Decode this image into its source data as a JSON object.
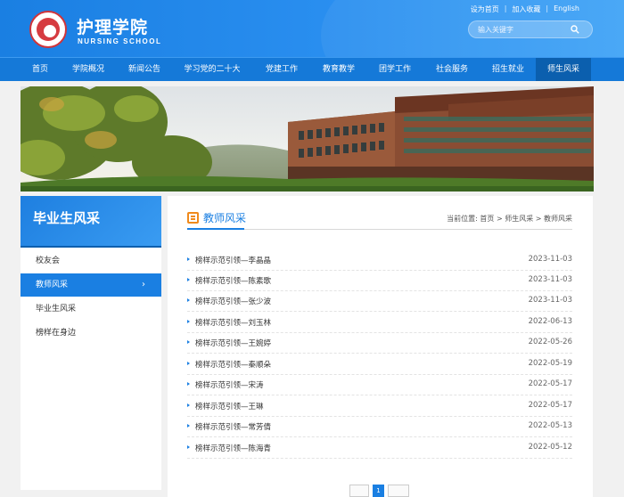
{
  "header": {
    "title": "护理学院",
    "subtitle": "NURSING SCHOOL",
    "logo_icon": "college-seal-logo",
    "top_links": [
      "设为首页",
      "加入收藏",
      "English"
    ],
    "search_placeholder": "输入关键字"
  },
  "nav": {
    "items": [
      "首页",
      "学院概况",
      "新闻公告",
      "学习党的二十大",
      "党建工作",
      "教育教学",
      "团学工作",
      "社会服务",
      "招生就业",
      "师生风采"
    ],
    "active": "师生风采"
  },
  "sidebar": {
    "heading": "毕业生风采",
    "items": [
      {
        "label": "校友会"
      },
      {
        "label": "教师风采"
      },
      {
        "label": "毕业生风采"
      },
      {
        "label": "榜样在身边"
      }
    ],
    "active_index": 1
  },
  "main": {
    "section_title": "教师风采",
    "breadcrumb": {
      "prefix": "当前位置:",
      "home": "首页",
      "level1": "师生风采",
      "level2": "教师风采",
      "sep": ">"
    },
    "articles": [
      {
        "title": "榜样示范引领—李晶晶",
        "date": "2023-11-03"
      },
      {
        "title": "榜样示范引领—陈素歌",
        "date": "2023-11-03"
      },
      {
        "title": "榜样示范引领—张少波",
        "date": "2023-11-03"
      },
      {
        "title": "榜样示范引领—刘玉林",
        "date": "2022-06-13"
      },
      {
        "title": "榜样示范引领—王婉婷",
        "date": "2022-05-26"
      },
      {
        "title": "榜样示范引领—秦顺朵",
        "date": "2022-05-19"
      },
      {
        "title": "榜样示范引领—宋涛",
        "date": "2022-05-17"
      },
      {
        "title": "榜样示范引领—王琳",
        "date": "2022-05-17"
      },
      {
        "title": "榜样示范引领—常芳倩",
        "date": "2022-05-13"
      },
      {
        "title": "榜样示范引领—陈海青",
        "date": "2022-05-12"
      }
    ],
    "pagination": {
      "current": "1"
    }
  },
  "colors": {
    "brand_blue": "#1a7fe2",
    "nav_active": "#0b5fae",
    "accent_orange": "#f08a1c"
  }
}
